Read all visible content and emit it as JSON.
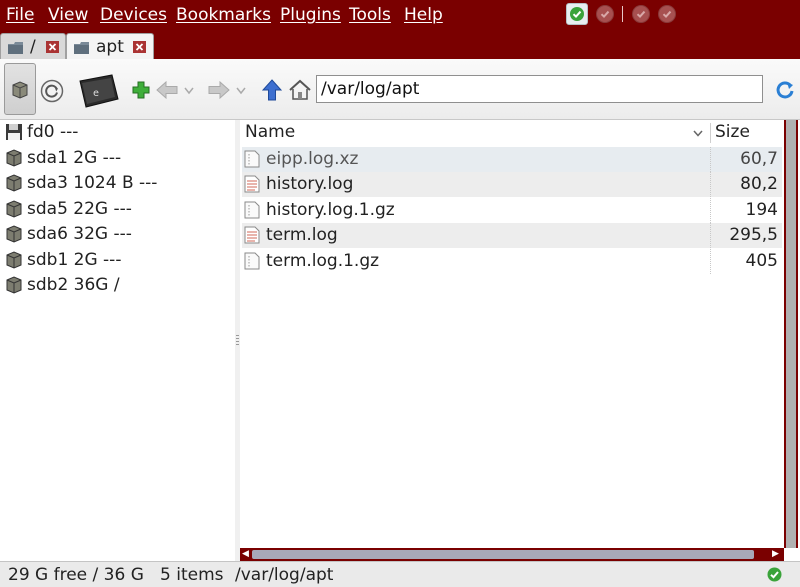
{
  "menu": {
    "items": [
      {
        "label": "File"
      },
      {
        "label": "View"
      },
      {
        "label": "Devices"
      },
      {
        "label": "Bookmarks"
      },
      {
        "label": "Plugins"
      },
      {
        "label": "Tools"
      },
      {
        "label": "Help"
      }
    ]
  },
  "tabs": [
    {
      "label": "/"
    },
    {
      "label": "apt"
    }
  ],
  "toolbar": {
    "address": "/var/log/apt"
  },
  "sidebar": {
    "devices": [
      {
        "label": "fd0 ---",
        "icon": "floppy-icon"
      },
      {
        "label": "sda1 2G ---",
        "icon": "drive-icon"
      },
      {
        "label": "sda3 1024 B ---",
        "icon": "drive-icon"
      },
      {
        "label": "sda5 22G ---",
        "icon": "drive-icon"
      },
      {
        "label": "sda6 32G ---",
        "icon": "drive-icon"
      },
      {
        "label": "sdb1 2G ---",
        "icon": "drive-icon"
      },
      {
        "label": "sdb2 36G /",
        "icon": "drive-icon"
      }
    ]
  },
  "filelist": {
    "columns": {
      "name": "Name",
      "size": "Size"
    },
    "rows": [
      {
        "name": "eipp.log.xz",
        "size": "60,7",
        "icon": "archive-file-icon"
      },
      {
        "name": "history.log",
        "size": "80,2",
        "icon": "text-file-icon"
      },
      {
        "name": "history.log.1.gz",
        "size": "194",
        "icon": "archive-file-icon"
      },
      {
        "name": "term.log",
        "size": "295,5",
        "icon": "text-file-icon"
      },
      {
        "name": "term.log.1.gz",
        "size": "405",
        "icon": "archive-file-icon"
      }
    ]
  },
  "status": {
    "free": "29 G free / 36 G",
    "items": "5 items",
    "path": "/var/log/apt"
  },
  "colors": {
    "chrome": "#7a0000",
    "selected_row": "#e7ecf0",
    "alt_row": "#ededed"
  }
}
